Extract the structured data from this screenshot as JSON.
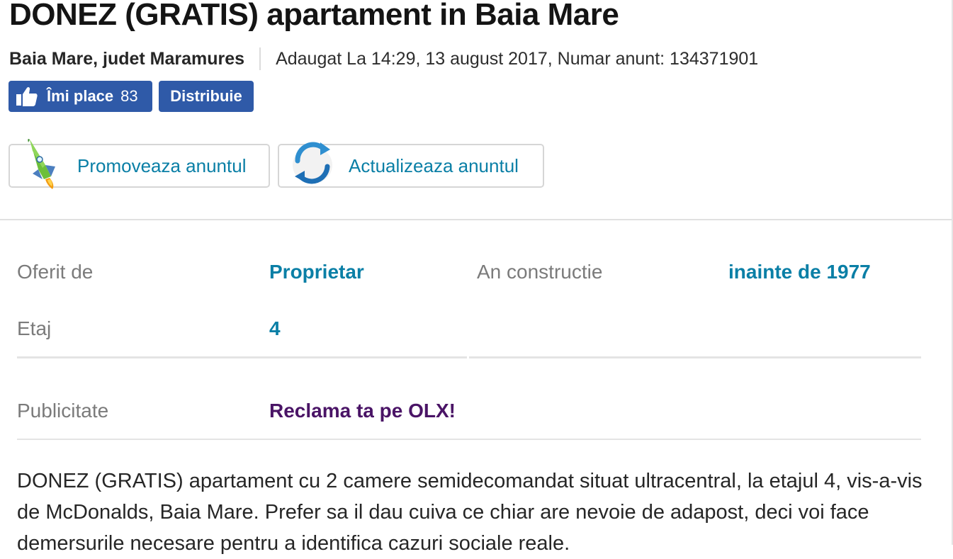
{
  "ad": {
    "title": "DONEZ (GRATIS) apartament in Baia Mare",
    "location": "Baia Mare, judet Maramures",
    "added_info": "Adaugat La 14:29, 13 august 2017, Numar anunt: 134371901"
  },
  "social": {
    "like_label": "Îmi place",
    "like_count": "83",
    "share_label": "Distribuie"
  },
  "actions": {
    "promote_label": "Promoveaza anuntul",
    "update_label": "Actualizeaza anuntul"
  },
  "details": {
    "offered_by_label": "Oferit de",
    "offered_by_value": "Proprietar",
    "construction_label": "An constructie",
    "construction_value": "inainte de 1977",
    "floor_label": "Etaj",
    "floor_value": "4"
  },
  "advertising": {
    "label": "Publicitate",
    "link": "Reclama ta pe OLX!"
  },
  "description": "DONEZ (GRATIS) apartament cu 2 camere semidecomandat situat ultracentral, la etajul 4, vis-a-vis de McDonalds, Baia Mare. Prefer sa il dau cuiva ce chiar are nevoie de adapost, deci voi face demersurile necesare pentru a identifica cazuri sociale reale.",
  "colors": {
    "link": "#0a7fa6",
    "facebook": "#2f5aa8",
    "ad_link": "#4a1466"
  },
  "icons": {
    "like": "thumbs-up-icon",
    "promote": "rocket-icon",
    "update": "refresh-icon"
  }
}
